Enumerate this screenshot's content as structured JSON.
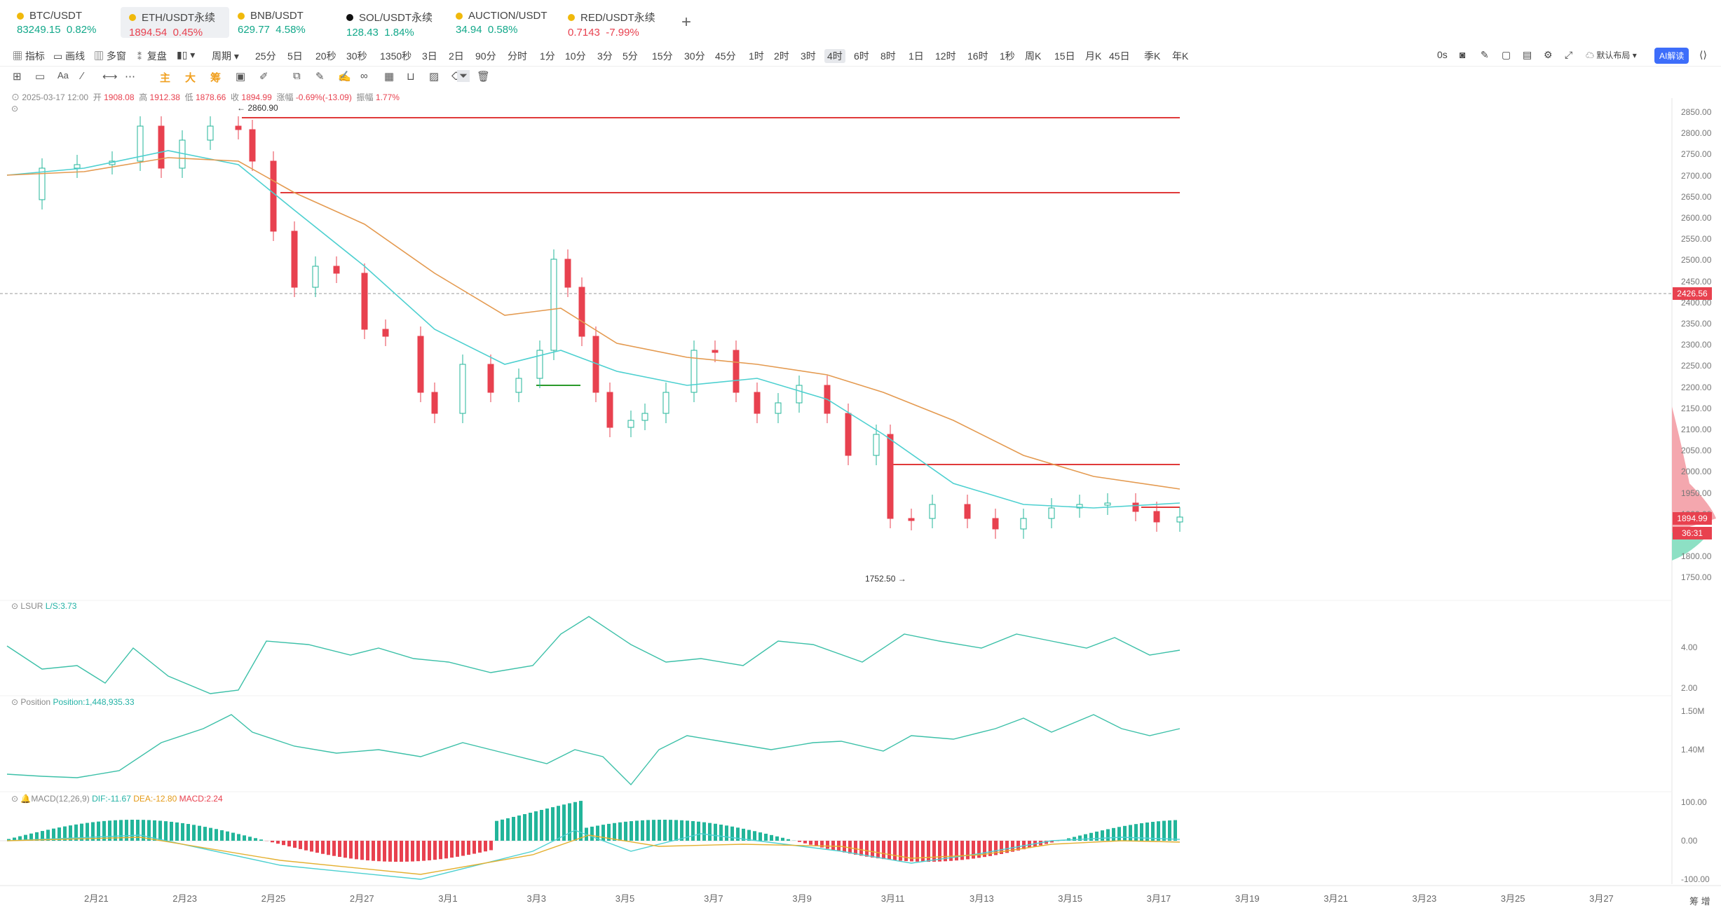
{
  "tabs": [
    {
      "symbol": "BTC/USDT",
      "price": "83249.15",
      "change": "0.82%",
      "dir": "up",
      "dot": "#f0b90b"
    },
    {
      "symbol": "ETH/USDT永续",
      "price": "1894.54",
      "change": "0.45%",
      "dir": "dn",
      "dot": "#f0b90b"
    },
    {
      "symbol": "BNB/USDT",
      "price": "629.77",
      "change": "4.58%",
      "dir": "up",
      "dot": "#f0b90b"
    },
    {
      "symbol": "SOL/USDT永续",
      "price": "128.43",
      "change": "1.84%",
      "dir": "up",
      "dot": "#111111"
    },
    {
      "symbol": "AUCTION/USDT",
      "price": "34.94",
      "change": "0.58%",
      "dir": "up",
      "dot": "#f0b90b"
    },
    {
      "symbol": "RED/USDT永续",
      "price": "0.7143",
      "change": "-7.99%",
      "dir": "dn",
      "dot": "#f0b90b"
    }
  ],
  "add_tab": "+",
  "toolbar": {
    "left": [
      "指标",
      "画线",
      "多窗",
      "复盘",
      "周期"
    ],
    "intervals": [
      "25分",
      "5日",
      "20秒",
      "30秒",
      "1350秒",
      "3日",
      "2日",
      "90分",
      "分时",
      "1分",
      "10分",
      "3分",
      "5分",
      "15分",
      "30分",
      "45分",
      "1时",
      "2时",
      "3时",
      "4时",
      "6时",
      "8时",
      "1日",
      "12时",
      "16时",
      "1秒",
      "周K",
      "15日",
      "月K",
      "45日",
      "季K",
      "年K"
    ],
    "selected": "4时",
    "right_countdown": "0s",
    "layout_label": "默认布局",
    "ai_label": "AI解读"
  },
  "draw_tools": {
    "main": "主",
    "big": "大",
    "chip": "筹"
  },
  "legend": {
    "date": "2025-03-17 12:00",
    "open_label": "开",
    "open": "1908.08",
    "high_label": "高",
    "high": "1912.38",
    "low_label": "低",
    "low": "1878.66",
    "close_label": "收",
    "close": "1894.99",
    "change_label": "涨幅",
    "change": "-0.69%(-13.09)",
    "amp_label": "振幅",
    "amp": "1.77%"
  },
  "annotations": {
    "high": "2860.90",
    "low": "1752.50"
  },
  "price_axis": [
    "2850.00",
    "2800.00",
    "2750.00",
    "2700.00",
    "2650.00",
    "2600.00",
    "2550.00",
    "2500.00",
    "2450.00",
    "2400.00",
    "2350.00",
    "2300.00",
    "2250.00",
    "2200.00",
    "2150.00",
    "2100.00",
    "2050.00",
    "2000.00",
    "1950.00",
    "1900.00",
    "1850.00",
    "1800.00",
    "1750.00"
  ],
  "crosshair_price": "2426.56",
  "last_price": "1894.99",
  "countdown": "36:31",
  "lsur": {
    "name": "LSUR",
    "value": "L/S:3.73",
    "axis": [
      "4.00",
      "2.00"
    ]
  },
  "position": {
    "name": "Position",
    "value": "Position:1,448,935.33",
    "axis": [
      "1.50M",
      "1.40M"
    ]
  },
  "macd": {
    "name": "MACD(12,26,9)",
    "dif": "DIF:-11.67",
    "dea": "DEA:-12.80",
    "macd": "MACD:2.24",
    "axis": [
      "100.00",
      "0.00",
      "-100.00"
    ]
  },
  "time_axis": [
    "2月21",
    "2月23",
    "2月25",
    "2月27",
    "3月1",
    "3月3",
    "3月5",
    "3月7",
    "3月9",
    "3月11",
    "3月13",
    "3月15",
    "3月17",
    "3月19",
    "3月21",
    "3月23",
    "3月25",
    "3月27"
  ],
  "corner": "筹 增"
}
